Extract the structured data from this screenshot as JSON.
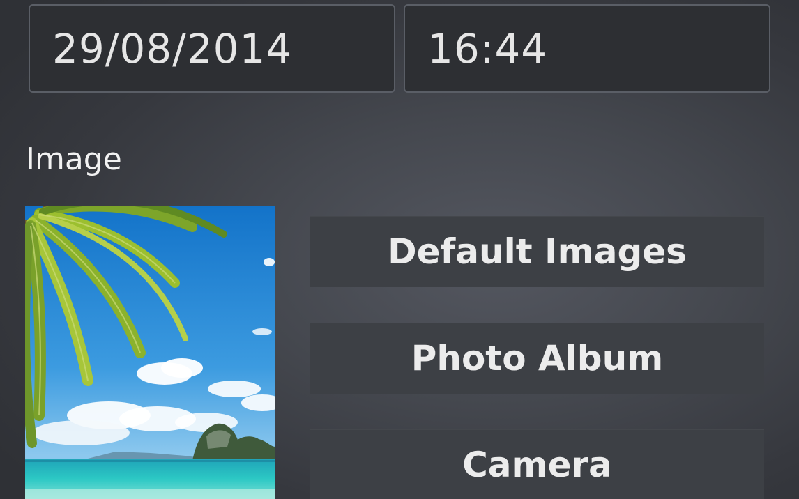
{
  "date_field": {
    "value": "29/08/2014"
  },
  "time_field": {
    "value": "16:44"
  },
  "image_section": {
    "label": "Image"
  },
  "buttons": {
    "default_images": "Default Images",
    "photo_album": "Photo Album",
    "camera": "Camera"
  },
  "colors": {
    "background": "#45484f",
    "field_bg": "#2d2f33",
    "field_border": "#5a5e66",
    "button_bg": "#3d4045",
    "text": "#eeeeee"
  }
}
